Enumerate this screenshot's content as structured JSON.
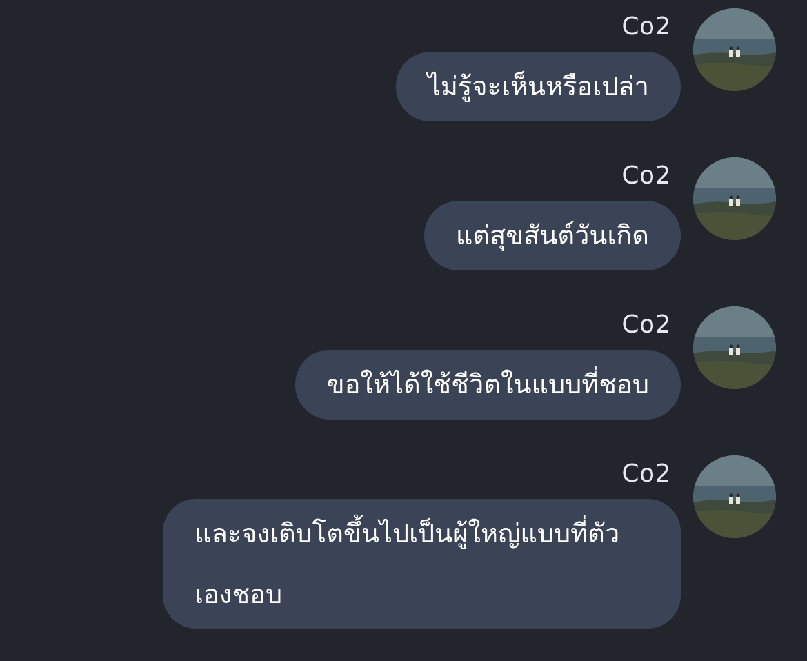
{
  "messages": [
    {
      "sender": "Co2",
      "text": "ไม่รู้จะเห็นหรือเปล่า"
    },
    {
      "sender": "Co2",
      "text": "แต่สุขสันต์วันเกิด"
    },
    {
      "sender": "Co2",
      "text": "ขอให้ได้ใช้ชีวิตในแบบที่ชอบ"
    },
    {
      "sender": "Co2",
      "text": "และจงเติบโตขึ้นไปเป็นผู้ใหญ่แบบที่ตัวเองชอบ"
    }
  ],
  "avatar": {
    "icon": "avatar-seaside-photo"
  },
  "colors": {
    "background": "#23252d",
    "bubble": "#3b4456",
    "text": "#ffffff",
    "sender": "#e6e8ee"
  }
}
